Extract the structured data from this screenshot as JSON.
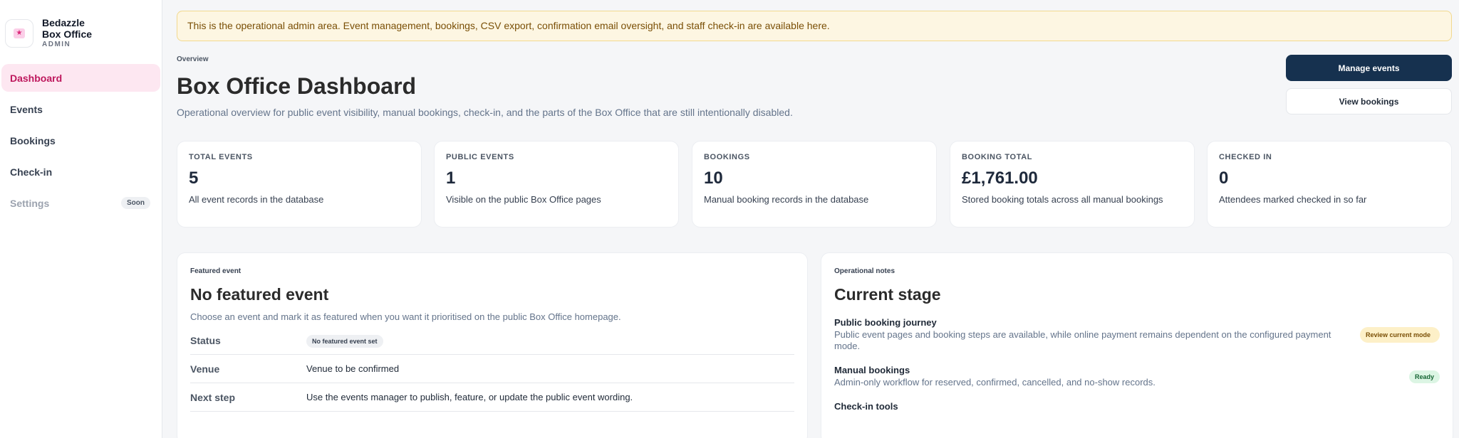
{
  "sidebar": {
    "brand": {
      "line1": "Bedazzle",
      "line2": "Box Office",
      "role": "ADMIN",
      "logo_icon": "star-icon"
    },
    "items": [
      {
        "label": "Dashboard",
        "state": "active"
      },
      {
        "label": "Events",
        "state": "normal"
      },
      {
        "label": "Bookings",
        "state": "normal"
      },
      {
        "label": "Check-in",
        "state": "normal"
      },
      {
        "label": "Settings",
        "state": "disabled",
        "badge": "Soon"
      }
    ]
  },
  "notice": "This is the operational admin area. Event management, bookings, CSV export, confirmation email oversight, and staff check-in are available here.",
  "header": {
    "overview": "Overview",
    "title": "Box Office Dashboard",
    "subtitle": "Operational overview for public event visibility, manual bookings, check-in, and the parts of the Box Office that are still intentionally disabled.",
    "primary_button": "Manage events",
    "secondary_button": "View bookings"
  },
  "stats": [
    {
      "label": "TOTAL EVENTS",
      "value": "5",
      "desc": "All event records in the database"
    },
    {
      "label": "PUBLIC EVENTS",
      "value": "1",
      "desc": "Visible on the public Box Office pages"
    },
    {
      "label": "BOOKINGS",
      "value": "10",
      "desc": "Manual booking records in the database"
    },
    {
      "label": "BOOKING TOTAL",
      "value": "£1,761.00",
      "desc": "Stored booking totals across all manual bookings"
    },
    {
      "label": "CHECKED IN",
      "value": "0",
      "desc": "Attendees marked checked in so far"
    }
  ],
  "featured": {
    "eyebrow": "Featured event",
    "title": "No featured event",
    "subtitle": "Choose an event and mark it as featured when you want it prioritised on the public Box Office homepage.",
    "rows": [
      {
        "key": "Status",
        "value": "No featured event set"
      },
      {
        "key": "Venue",
        "value": "Venue to be confirmed"
      },
      {
        "key": "Next step",
        "value": "Use the events manager to publish, feature, or update the public event wording."
      }
    ]
  },
  "operational": {
    "eyebrow": "Operational notes",
    "title": "Current stage",
    "notes": [
      {
        "title": "Public booking journey",
        "desc": "Public event pages and booking steps are available, while online payment remains dependent on the configured payment mode.",
        "badge": "Review current mode"
      },
      {
        "title": "Manual bookings",
        "desc": "Admin-only workflow for reserved, confirmed, cancelled, and no-show records.",
        "badge": "Ready"
      },
      {
        "title": "Check-in tools",
        "desc": "",
        "badge": ""
      }
    ]
  },
  "colors": {
    "accent": "#be185d",
    "primary": "#16314f",
    "notice_bg": "#fdf6e2"
  }
}
